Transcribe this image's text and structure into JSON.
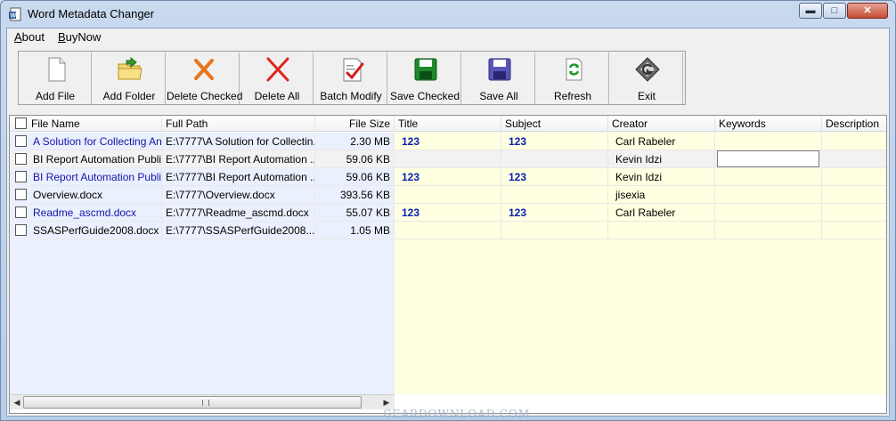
{
  "window": {
    "title": "Word Metadata Changer",
    "minimize": "▬",
    "maximize": "□",
    "close": "✕"
  },
  "menu": {
    "about_u": "A",
    "about_rest": "bout",
    "buynow_u": "B",
    "buynow_rest": "uyNow"
  },
  "toolbar": {
    "add_file": "Add File",
    "add_folder": "Add Folder",
    "delete_checked": "Delete Checked",
    "delete_all": "Delete All",
    "batch_modify": "Batch Modify",
    "save_checked": "Save Checked",
    "save_all": "Save All",
    "refresh": "Refresh",
    "exit": "Exit"
  },
  "columns": {
    "file_name": "File Name",
    "full_path": "Full Path",
    "file_size": "File Size",
    "title": "Title",
    "subject": "Subject",
    "creator": "Creator",
    "keywords": "Keywords",
    "description": "Description"
  },
  "rows": [
    {
      "name": "A Solution for Collecting An...",
      "path": "E:\\7777\\A Solution for Collectin...",
      "size": "2.30 MB",
      "title": "123",
      "subject": "123",
      "creator": "Carl Rabeler",
      "keywords": "",
      "description": ""
    },
    {
      "name": "BI Report Automation Publis...",
      "path": "E:\\7777\\BI Report Automation ...",
      "size": "59.06 KB",
      "title": "",
      "subject": "",
      "creator": "Kevin Idzi",
      "keywords": "",
      "description": ""
    },
    {
      "name": "BI Report Automation Publis...",
      "path": "E:\\7777\\BI Report Automation ...",
      "size": "59.06 KB",
      "title": "123",
      "subject": "123",
      "creator": "Kevin Idzi",
      "keywords": "",
      "description": ""
    },
    {
      "name": "Overview.docx",
      "path": "E:\\7777\\Overview.docx",
      "size": "393.56 KB",
      "title": "",
      "subject": "",
      "creator": "jisexia",
      "keywords": "",
      "description": ""
    },
    {
      "name": "Readme_ascmd.docx",
      "path": "E:\\7777\\Readme_ascmd.docx",
      "size": "55.07 KB",
      "title": "123",
      "subject": "123",
      "creator": "Carl Rabeler",
      "keywords": "",
      "description": ""
    },
    {
      "name": "SSASPerfGuide2008.docx",
      "path": "E:\\7777\\SSASPerfGuide2008....",
      "size": "1.05 MB",
      "title": "",
      "subject": "",
      "creator": "",
      "keywords": "",
      "description": ""
    }
  ],
  "colors": {
    "left_pane": "#eaf0fd",
    "right_pane": "#ffffe1",
    "link_blue": "#1515a8",
    "metadata_blue": "#0a20b0"
  },
  "watermark": "GEARDOWNLOAD.COM"
}
